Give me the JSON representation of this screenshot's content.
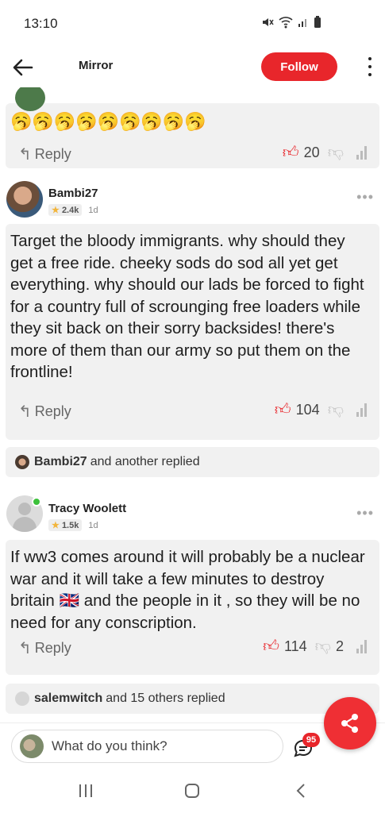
{
  "status_bar": {
    "time": "13:10",
    "icons": [
      "mute-icon",
      "wifi-icon",
      "signal-icon",
      "battery-icon"
    ]
  },
  "app_bar": {
    "title": "Mirror",
    "follow_label": "Follow",
    "back_icon": "back-arrow-icon",
    "more_icon": "more-vertical-icon"
  },
  "colors": {
    "accent": "#e8262b",
    "card_bg": "#f1f1f1",
    "online": "#3cc13b"
  },
  "prev_comment": {
    "emojis": "🥱🥱🥱🥱🥱🥱🥱🥱🥱",
    "reply_label": "Reply",
    "upvotes": "20"
  },
  "comments": [
    {
      "username": "Bambi27",
      "karma": "2.4k",
      "age": "1d",
      "text": "Target the bloody immigrants. why should they get a free ride. cheeky sods do sod all yet get everything. why should our lads be forced to fight for a country full of scrounging free loaders while they sit back on their sorry backsides! there's more of them than our army so put them on the frontline!",
      "reply_label": "Reply",
      "upvotes": "104",
      "downvotes": "",
      "replied": {
        "name": "Bambi27",
        "rest": "and another replied"
      }
    },
    {
      "username": "Tracy Woolett",
      "karma": "1.5k",
      "age": "1d",
      "text": "If ww3 comes around it will probably be a nuclear war and it will take a few minutes to destroy britain 🇬🇧 and the people in it , so they will be no need for any conscription.",
      "reply_label": "Reply",
      "upvotes": "114",
      "downvotes": "2",
      "replied": {
        "name": "salemwitch",
        "rest": "and 15 others replied"
      }
    }
  ],
  "bottom": {
    "input_placeholder": "What do you think?",
    "comment_count_badge": "95"
  }
}
